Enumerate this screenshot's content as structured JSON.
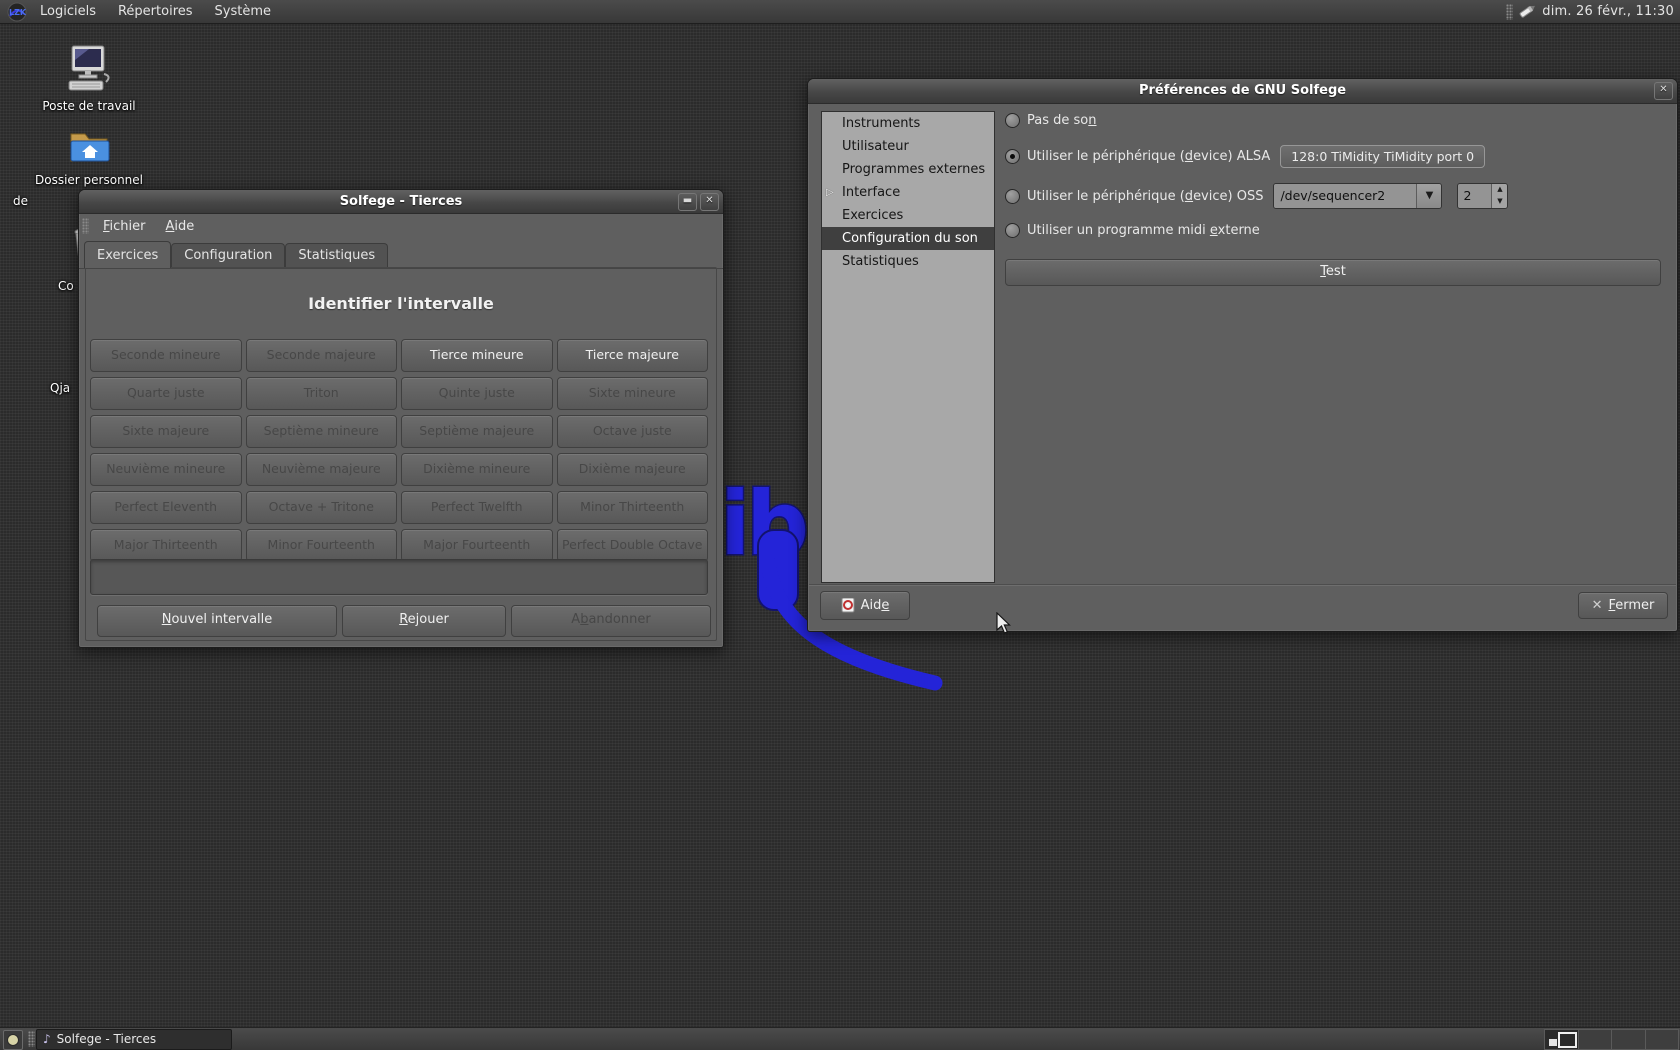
{
  "desktop": {
    "top_panel": {
      "menus": [
        {
          "label": "Logiciels"
        },
        {
          "label": "Répertoires"
        },
        {
          "label": "Système"
        }
      ],
      "clock": "dim. 26 févr., 11:30"
    },
    "icons": {
      "computer": {
        "label": "Poste de travail"
      },
      "home": {
        "label": "Dossier personnel",
        "label2": "de"
      },
      "trash": {
        "label": "Co"
      },
      "pen": {
        "label": "Qja"
      }
    },
    "wallpaper_text": "ib"
  },
  "solfege_window": {
    "title": "Solfege - Tierces",
    "menu": [
      {
        "label": "Fichier",
        "mn": 0
      },
      {
        "label": "Aide",
        "mn": 0
      }
    ],
    "tabs": [
      {
        "label": "Exercices",
        "active": true
      },
      {
        "label": "Configuration",
        "active": false
      },
      {
        "label": "Statistiques",
        "active": false
      }
    ],
    "heading": "Identifier l'intervalle",
    "intervals": [
      {
        "label": "Seconde mineure",
        "enabled": false
      },
      {
        "label": "Seconde majeure",
        "enabled": false
      },
      {
        "label": "Tierce mineure",
        "enabled": true
      },
      {
        "label": "Tierce majeure",
        "enabled": true
      },
      {
        "label": "Quarte juste",
        "enabled": false
      },
      {
        "label": "Triton",
        "enabled": false
      },
      {
        "label": "Quinte juste",
        "enabled": false
      },
      {
        "label": "Sixte mineure",
        "enabled": false
      },
      {
        "label": "Sixte majeure",
        "enabled": false
      },
      {
        "label": "Septième mineure",
        "enabled": false
      },
      {
        "label": "Septième majeure",
        "enabled": false
      },
      {
        "label": "Octave juste",
        "enabled": false
      },
      {
        "label": "Neuvième mineure",
        "enabled": false
      },
      {
        "label": "Neuvième majeure",
        "enabled": false
      },
      {
        "label": "Dixième mineure",
        "enabled": false
      },
      {
        "label": "Dixième majeure",
        "enabled": false
      },
      {
        "label": "Perfect Eleventh",
        "enabled": false
      },
      {
        "label": "Octave + Tritone",
        "enabled": false
      },
      {
        "label": "Perfect Twelfth",
        "enabled": false
      },
      {
        "label": "Minor Thirteenth",
        "enabled": false
      },
      {
        "label": "Major Thirteenth",
        "enabled": false
      },
      {
        "label": "Minor Fourteenth",
        "enabled": false
      },
      {
        "label": "Major Fourteenth",
        "enabled": false
      },
      {
        "label": "Perfect Double Octave",
        "enabled": false
      }
    ],
    "answer_entry": {
      "value": ""
    },
    "actions": [
      {
        "label": "Nouvel intervalle",
        "mn": 0,
        "enabled": true
      },
      {
        "label": "Rejouer",
        "mn": 0,
        "enabled": true
      },
      {
        "label": "Abandonner",
        "mn": 1,
        "enabled": false
      }
    ]
  },
  "preferences_dialog": {
    "title": "Préférences de GNU Solfege",
    "sidebar": [
      {
        "label": "Instruments",
        "selected": false,
        "expander": false
      },
      {
        "label": "Utilisateur",
        "selected": false,
        "expander": false
      },
      {
        "label": "Programmes externes",
        "selected": false,
        "expander": false
      },
      {
        "label": "Interface",
        "selected": false,
        "expander": true
      },
      {
        "label": "Exercices",
        "selected": false,
        "expander": false
      },
      {
        "label": "Configuration du son",
        "selected": true,
        "expander": false
      },
      {
        "label": "Statistiques",
        "selected": false,
        "expander": false
      }
    ],
    "sound": {
      "no_sound": {
        "label": "Pas de son",
        "mn": 9,
        "checked": false
      },
      "alsa": {
        "label": "Utiliser le périphérique (device) ALSA",
        "mn": 26,
        "checked": true,
        "value": "128:0 TiMidity TiMidity port 0"
      },
      "oss": {
        "label": "Utiliser le périphérique (device) OSS",
        "mn": 26,
        "checked": false,
        "device": "/dev/sequencer2",
        "port": "2"
      },
      "external_midi": {
        "label": "Utiliser un programme midi externe",
        "mn": 27,
        "checked": false
      },
      "test_button": {
        "label": "Test",
        "mn": 0
      }
    },
    "aide_button": {
      "label": "Aide",
      "mn": 3
    },
    "fermer_button": {
      "label": "Fermer",
      "mn": 0
    }
  },
  "taskbar": {
    "task": {
      "label": "Solfege - Tierces"
    }
  }
}
